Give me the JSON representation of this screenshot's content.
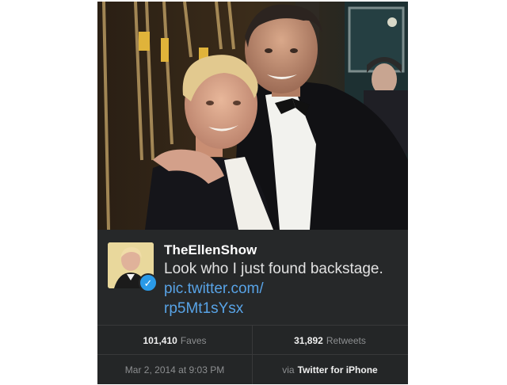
{
  "tweet": {
    "handle": "TheEllenShow",
    "text_plain": "Look who I just found backstage. ",
    "link_part1": "pic.twitter.com/",
    "link_part2": "rp5Mt1sYsx"
  },
  "stats": {
    "faves_count": "101,410",
    "faves_label": "Faves",
    "retweets_count": "31,892",
    "retweets_label": "Retweets"
  },
  "meta": {
    "timestamp": "Mar 2, 2014 at 9:03 PM",
    "via_label": "via",
    "source": "Twitter for iPhone"
  },
  "icons": {
    "verified": "verified-checkmark-icon"
  },
  "colors": {
    "card_bg": "#262829",
    "link": "#58a3e6",
    "verified": "#2a9ae8"
  }
}
